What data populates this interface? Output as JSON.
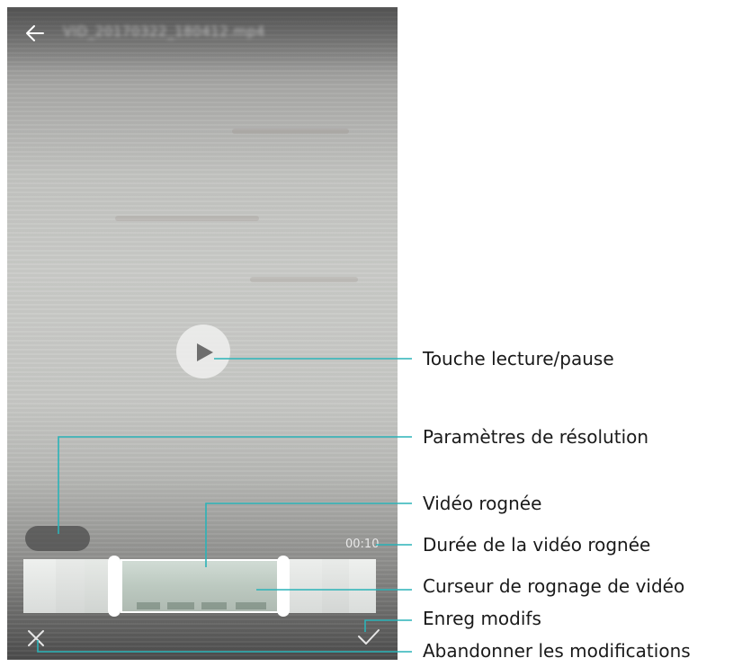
{
  "header": {
    "back_icon": "arrow-left-icon",
    "filename": "VID_20170322_180412.mp4"
  },
  "player": {
    "play_icon": "play-icon",
    "duration": "00:10"
  },
  "footer": {
    "cancel_icon": "close-icon",
    "save_icon": "check-icon"
  },
  "callouts": {
    "play_pause": "Touche lecture/pause",
    "resolution": "Paramètres de résolution",
    "cropped_video": "Vidéo rognée",
    "cropped_duration": "Durée de la vidéo rognée",
    "crop_slider": "Curseur de rognage de vidéo",
    "save": "Enreg modifs",
    "discard": "Abandonner les modifications"
  },
  "colors": {
    "leader_line": "#2bb3b8",
    "label_text": "#1a1a1a"
  }
}
